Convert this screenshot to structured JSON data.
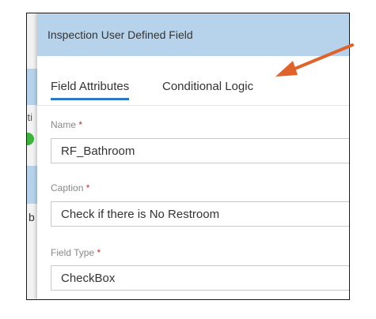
{
  "background": {
    "fragment1": "cti",
    "fragment2": "b"
  },
  "dialog": {
    "title": "Inspection User Defined Field",
    "tabs": [
      {
        "label": "Field Attributes",
        "active": true
      },
      {
        "label": "Conditional Logic",
        "active": false
      }
    ],
    "fields": {
      "name": {
        "label": "Name",
        "required_mark": "*",
        "value": "RF_Bathroom"
      },
      "caption": {
        "label": "Caption",
        "required_mark": "*",
        "value": "Check if there is No Restroom"
      },
      "field_type": {
        "label": "Field Type",
        "required_mark": "*",
        "value": "CheckBox"
      }
    }
  },
  "colors": {
    "header_bg": "#b7d3ec",
    "tab_accent": "#2d78c4",
    "required": "#e02424",
    "annotation_arrow": "#e0632a",
    "status_check": "#3ab43a"
  },
  "annotation": {
    "icon": "arrow-annotation-icon"
  }
}
